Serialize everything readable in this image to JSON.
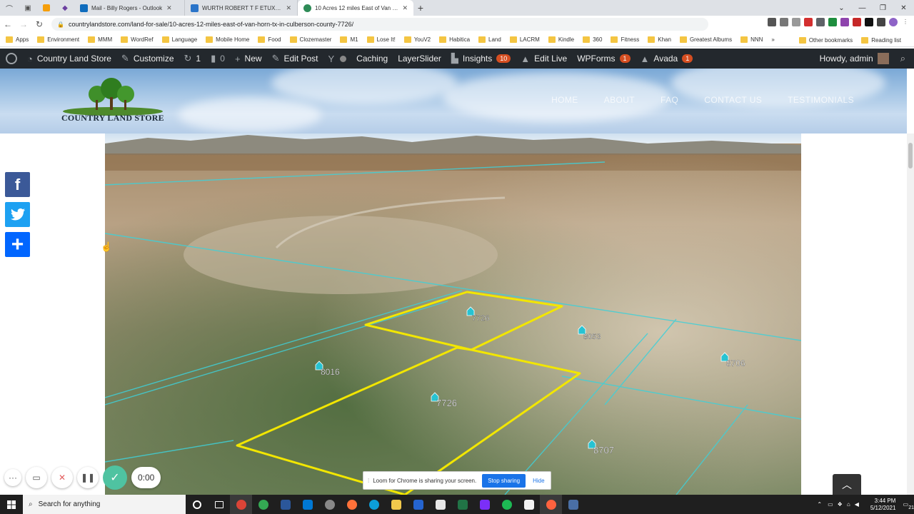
{
  "browser": {
    "tabs": [
      {
        "title": "",
        "icon": "pin-icon"
      },
      {
        "title": "",
        "icon": "bookmark-icon"
      },
      {
        "title": "",
        "icon": "orange-app-icon"
      },
      {
        "title": "",
        "icon": "purple-app-icon"
      },
      {
        "title": "Mail - Billy Rogers - Outlook",
        "icon": "outlook-icon",
        "color": "#0f6cbd"
      },
      {
        "title": "WURTH ROBERT T F ETUX 10 Acr",
        "icon": "doc-icon",
        "color": "#2a74c9"
      },
      {
        "title": "10 Acres 12 miles East of Van Ho",
        "icon": "tree-icon",
        "color": "#2e8b57",
        "active": true
      }
    ],
    "url": "countrylandstore.com/land-for-sale/10-acres-12-miles-east-of-van-horn-tx-in-culberson-county-7726/",
    "bookmarks": [
      "Apps",
      "Environment",
      "MMM",
      "WordRef",
      "Language",
      "Mobile Home",
      "Food",
      "Clozemaster",
      "M1",
      "Lose It!",
      "YouV2",
      "Habitica",
      "Land",
      "LACRM",
      "Kindle",
      "360",
      "Fitness",
      "Khan",
      "Greatest Albums",
      "NNN"
    ],
    "bookmarks_right": [
      "Other bookmarks",
      "Reading list"
    ]
  },
  "wp_admin": {
    "site_name": "Country Land Store",
    "customize": "Customize",
    "updates": "1",
    "comments": "0",
    "new": "New",
    "edit_post": "Edit Post",
    "caching": "Caching",
    "layerslider": "LayerSlider",
    "insights": "Insights",
    "insights_badge": "10",
    "edit_live": "Edit Live",
    "wpforms": "WPForms",
    "wpforms_badge": "1",
    "avada": "Avada",
    "avada_badge": "1",
    "howdy": "Howdy, admin"
  },
  "site": {
    "logo_text": "COUNTRY LAND STORE",
    "nav": [
      "HOME",
      "ABOUT",
      "FAQ",
      "CONTACT US",
      "TESTIMONIALS"
    ]
  },
  "map": {
    "parcel_labels": [
      "7726",
      "8053",
      "8016",
      "7726",
      "8706",
      "8707"
    ],
    "parcel_color": "#f2e600",
    "boundary_color": "#3fd0d8"
  },
  "social": [
    {
      "name": "facebook",
      "glyph": "f",
      "color": "#3b5998"
    },
    {
      "name": "twitter",
      "glyph": "t",
      "color": "#1da1f2"
    },
    {
      "name": "share",
      "glyph": "+",
      "color": "#0166ff"
    }
  ],
  "loom": {
    "timer": "0:00",
    "sharing_text": "Loom for Chrome is sharing your screen.",
    "stop_label": "Stop sharing",
    "hide_label": "Hide"
  },
  "taskbar": {
    "search_placeholder": "Search for anything",
    "time": "3:44 PM",
    "date": "5/12/2021",
    "notification_count": "21"
  }
}
